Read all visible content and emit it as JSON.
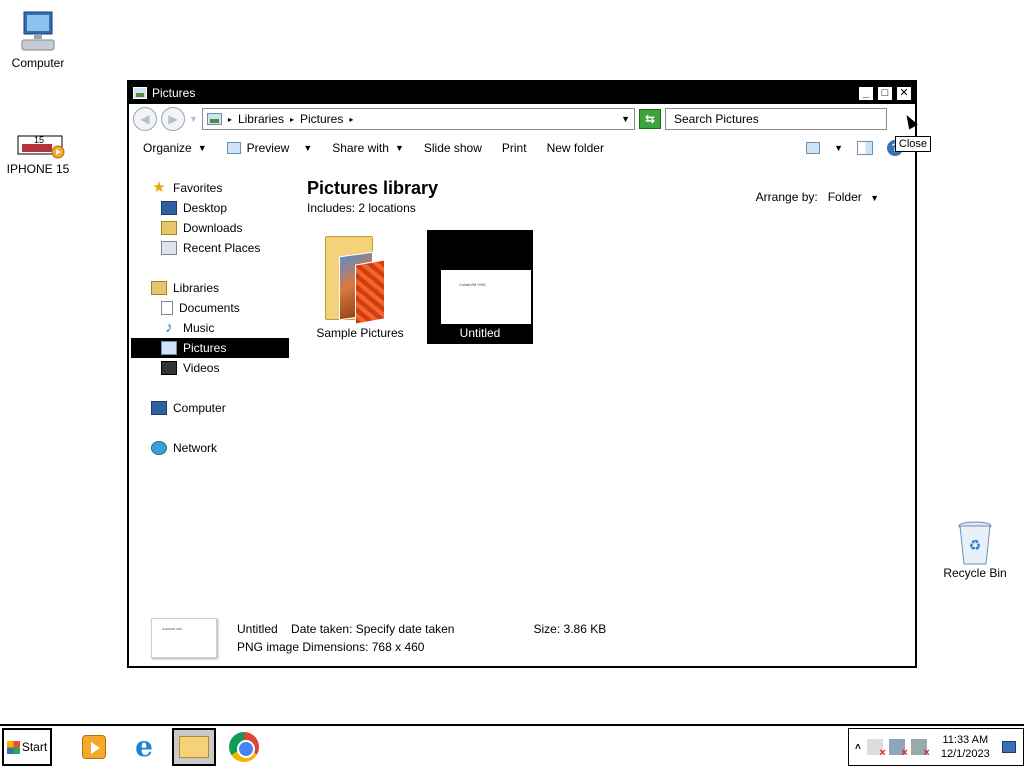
{
  "desktop": {
    "icons": [
      {
        "label": "Computer"
      },
      {
        "label": "IPHONE 15",
        "badge": "15"
      },
      {
        "label": "Recycle Bin"
      }
    ]
  },
  "window": {
    "title": "Pictures",
    "buttons": {
      "minimize": "_",
      "maximize": "□",
      "close": "✕"
    },
    "tooltip": "Close",
    "address": {
      "crumbs": [
        "Libraries",
        "Pictures"
      ]
    },
    "search_placeholder": "Search Pictures",
    "toolbar": {
      "organize": "Organize",
      "preview": "Preview",
      "share_with": "Share with",
      "slide_show": "Slide show",
      "print": "Print",
      "new_folder": "New folder"
    },
    "nav": {
      "favorites": "Favorites",
      "favorites_items": [
        "Desktop",
        "Downloads",
        "Recent Places"
      ],
      "libraries": "Libraries",
      "libraries_items": [
        "Documents",
        "Music",
        "Pictures",
        "Videos"
      ],
      "computer": "Computer",
      "network": "Network",
      "selected": "Pictures"
    },
    "content": {
      "title": "Pictures library",
      "includes": "Includes:",
      "locations": "2 locations",
      "arrange_label": "Arrange by:",
      "arrange_value": "Folder",
      "items": [
        {
          "name": "Sample Pictures",
          "type": "folder"
        },
        {
          "name": "Untitled",
          "type": "image",
          "selected": true,
          "thumb_text": "CollabVM VNS"
        }
      ]
    },
    "details": {
      "name": "Untitled",
      "date_label": "Date taken:",
      "date_value": "Specify date taken",
      "size_label": "Size:",
      "size_value": "3.86 KB",
      "type": "PNG image",
      "dims_label": "Dimensions:",
      "dims_value": "768 x 460"
    }
  },
  "taskbar": {
    "start": "Start",
    "apps": [
      "windows-media-player",
      "internet-explorer",
      "windows-explorer",
      "google-chrome"
    ],
    "active_app": "windows-explorer",
    "time": "11:33 AM",
    "date": "12/1/2023"
  },
  "colors": {
    "selection": "#000000",
    "titlebar": "#000000",
    "desktop": "#ffffff"
  }
}
